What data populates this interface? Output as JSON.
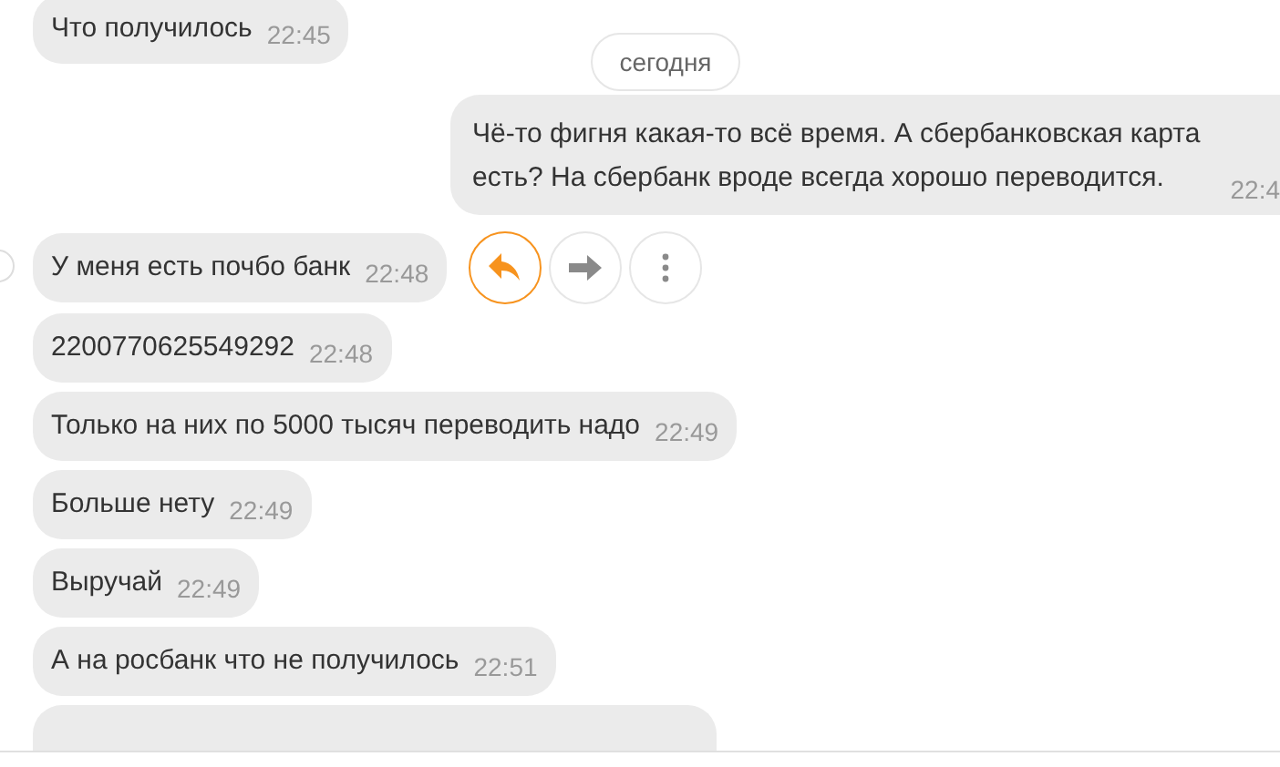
{
  "messages": [
    {
      "kind": "incoming",
      "text": "Что получилось",
      "time": "22:45"
    },
    {
      "kind": "date",
      "text": "сегодня"
    },
    {
      "kind": "outgoing",
      "text": "Чё-то фигня какая-то всё время. А сбербанковская карта есть? На сбербанк вроде всегда хорошо переводится.",
      "time": "22:4"
    },
    {
      "kind": "incoming",
      "text": "У меня есть почбо банк",
      "time": "22:48",
      "hovered": true
    },
    {
      "kind": "incoming",
      "text": "2200770625549292",
      "time": "22:48"
    },
    {
      "kind": "incoming",
      "text": "Только на них по 5000 тысяч переводить надо",
      "time": "22:49"
    },
    {
      "kind": "incoming",
      "text": "Больше нету",
      "time": "22:49"
    },
    {
      "kind": "incoming",
      "text": "Выручай",
      "time": "22:49"
    },
    {
      "kind": "incoming",
      "text": "А на росбанк что не получилось",
      "time": "22:51"
    },
    {
      "kind": "partial"
    }
  ]
}
